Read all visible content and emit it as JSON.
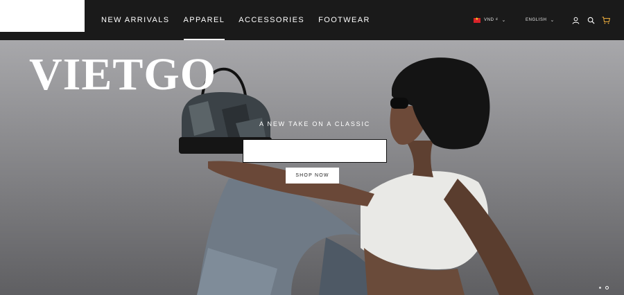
{
  "header": {
    "nav": [
      {
        "label": "NEW ARRIVALS"
      },
      {
        "label": "APPAREL"
      },
      {
        "label": "ACCESSORIES"
      },
      {
        "label": "FOOTWEAR"
      }
    ],
    "active_nav": "APPAREL",
    "currency_label": "VND ₫",
    "language_label": "ENGLISH",
    "icons": [
      "flag-vietnam-icon",
      "chevron-down-icon",
      "user-icon",
      "search-icon",
      "cart-icon"
    ]
  },
  "hero": {
    "brand": "VIETGO",
    "tagline": "A NEW TAKE ON A CLASSIC",
    "cta_label": "SHOP NOW",
    "slide_count": 2,
    "active_slide": 2
  },
  "colors": {
    "header_bg": "#1a1a1a",
    "cart_accent": "#e0a43a",
    "hero_bg": "#a9a9ac"
  }
}
